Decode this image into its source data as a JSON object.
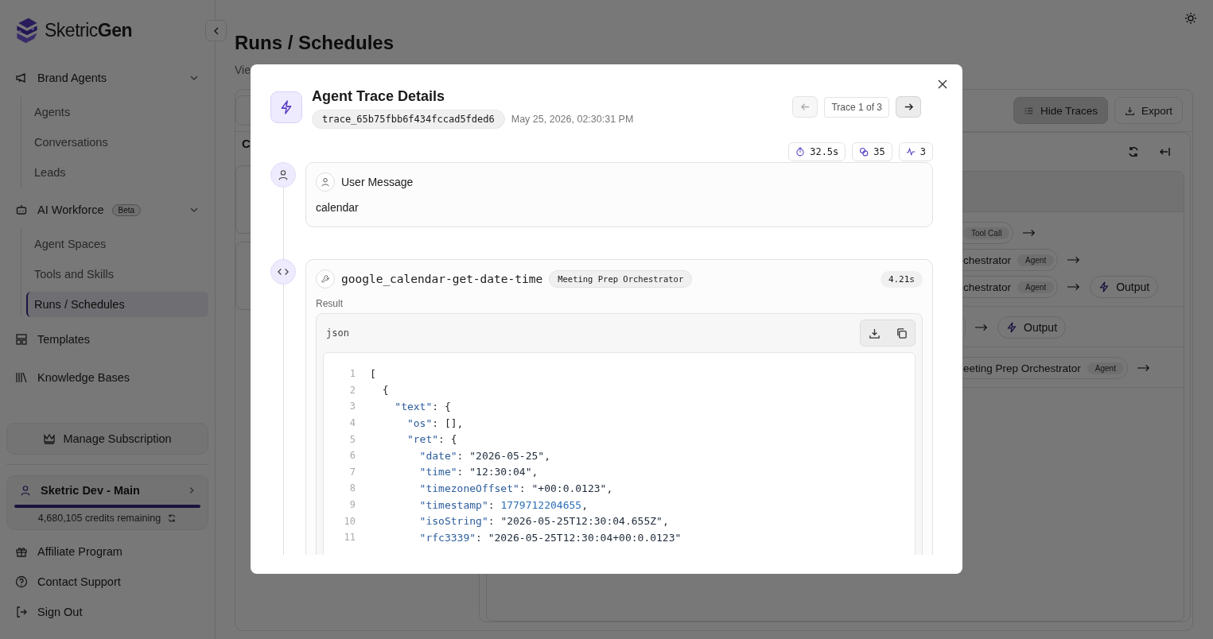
{
  "sidebar": {
    "logo": "Sketric**Gen**",
    "nav": [
      {
        "kind": "group",
        "label": "Brand Agents",
        "expanded": true,
        "selected": false,
        "children": [
          {
            "label": "Agents",
            "selected": false
          },
          {
            "label": "Conversations",
            "selected": false
          },
          {
            "label": "Leads",
            "selected": false
          }
        ]
      },
      {
        "kind": "group",
        "label": "AI Workforce",
        "badge": "Beta",
        "expanded": true,
        "selected": false,
        "children": [
          {
            "label": "Agent Spaces",
            "selected": false
          },
          {
            "label": "Tools and Skills",
            "selected": false
          },
          {
            "label": "Runs / Schedules",
            "selected": true
          }
        ]
      },
      {
        "kind": "link",
        "label": "Templates",
        "selected": false
      },
      {
        "kind": "link",
        "label": "Knowledge Bases",
        "selected": false
      }
    ],
    "subscription_button": "Manage Subscription",
    "workspace": {
      "name": "Sketric Dev - Main",
      "level": 1.0,
      "credits": "4,680,105 credits remaining"
    },
    "footer": [
      {
        "label": "Affiliate Program"
      },
      {
        "label": "Contact Support"
      },
      {
        "label": "Sign Out"
      }
    ]
  },
  "page": {
    "title": "Runs / Schedules",
    "subtitle": "Vie",
    "section_heading": "C",
    "toolbar": [
      {
        "label": "Hide Traces",
        "selected": true
      },
      {
        "label": "Export",
        "selected": false
      }
    ],
    "flow_blocks": [
      {
        "lines": [
          {
            "nodes": [
              {
                "kind": "tag",
                "tag": "Tool Call"
              }
            ]
          },
          {
            "nodes": [
              {
                "kind": "agent",
                "name": "chestrator",
                "tag": "Agent"
              }
            ]
          },
          {
            "nodes": [
              {
                "kind": "agent",
                "name": "chestrator",
                "tag": "Agent"
              },
              {
                "kind": "output",
                "name": "Output"
              }
            ]
          }
        ]
      },
      {
        "lines": [
          {
            "nodes": [
              {
                "kind": "blank"
              },
              {
                "kind": "output",
                "name": "Output"
              }
            ]
          }
        ]
      },
      {
        "lines": [
          {
            "nodes": [
              {
                "kind": "agent",
                "name": "eeting Prep Orchestrator",
                "tag": "Agent"
              }
            ]
          }
        ]
      }
    ]
  },
  "modal": {
    "title": "Agent Trace Details",
    "trace_id": "trace_65b75fbb6f434fccad5fded6",
    "timestamp": "May 25, 2026, 02:30:31 PM",
    "pager": {
      "label": "Trace 1 of 3",
      "prev_disabled": true,
      "next_disabled": false
    },
    "stats": [
      {
        "value": "32.5s"
      },
      {
        "value": "35"
      },
      {
        "value": "3"
      }
    ],
    "steps": [
      {
        "kind": "message",
        "title": "User Message",
        "text": "calendar"
      },
      {
        "kind": "tool",
        "name": "google_calendar-get-date-time",
        "agent": "Meeting Prep Orchestrator",
        "duration": "4.21s",
        "result_label": "Result",
        "language": "json",
        "lines": [
          {
            "number": "1",
            "tokens": [
              {
                "kind": "punct",
                "text": "["
              }
            ]
          },
          {
            "number": "2",
            "tokens": [
              {
                "kind": "punct",
                "text": "  {"
              }
            ]
          },
          {
            "number": "3",
            "tokens": [
              {
                "kind": "key",
                "text": "    \"text\""
              },
              {
                "kind": "punct",
                "text": ": {"
              }
            ]
          },
          {
            "number": "4",
            "tokens": [
              {
                "kind": "key",
                "text": "      \"os\""
              },
              {
                "kind": "punct",
                "text": ": [],"
              }
            ]
          },
          {
            "number": "5",
            "tokens": [
              {
                "kind": "key",
                "text": "      \"ret\""
              },
              {
                "kind": "punct",
                "text": ": {"
              }
            ]
          },
          {
            "number": "6",
            "tokens": [
              {
                "kind": "key",
                "text": "        \"date\""
              },
              {
                "kind": "punct",
                "text": ": "
              },
              {
                "kind": "str",
                "text": "\"2026-05-25\""
              },
              {
                "kind": "punct",
                "text": ","
              }
            ]
          },
          {
            "number": "7",
            "tokens": [
              {
                "kind": "key",
                "text": "        \"time\""
              },
              {
                "kind": "punct",
                "text": ": "
              },
              {
                "kind": "str",
                "text": "\"12:30:04\""
              },
              {
                "kind": "punct",
                "text": ","
              }
            ]
          },
          {
            "number": "8",
            "tokens": [
              {
                "kind": "key",
                "text": "        \"timezoneOffset\""
              },
              {
                "kind": "punct",
                "text": ": "
              },
              {
                "kind": "str",
                "text": "\"+00:0.0123\""
              },
              {
                "kind": "punct",
                "text": ","
              }
            ]
          },
          {
            "number": "9",
            "tokens": [
              {
                "kind": "key",
                "text": "        \"timestamp\""
              },
              {
                "kind": "punct",
                "text": ": "
              },
              {
                "kind": "num",
                "text": "1779712204655"
              },
              {
                "kind": "punct",
                "text": ","
              }
            ]
          },
          {
            "number": "10",
            "tokens": [
              {
                "kind": "key",
                "text": "        \"isoString\""
              },
              {
                "kind": "punct",
                "text": ": "
              },
              {
                "kind": "str",
                "text": "\"2026-05-25T12:30:04.655Z\""
              },
              {
                "kind": "punct",
                "text": ","
              }
            ]
          },
          {
            "number": "11",
            "tokens": [
              {
                "kind": "key",
                "text": "        \"rfc3339\""
              },
              {
                "kind": "punct",
                "text": ": "
              },
              {
                "kind": "str",
                "text": "\"2026-05-25T12:30:04+00:0.0123\""
              }
            ]
          }
        ]
      }
    ]
  }
}
